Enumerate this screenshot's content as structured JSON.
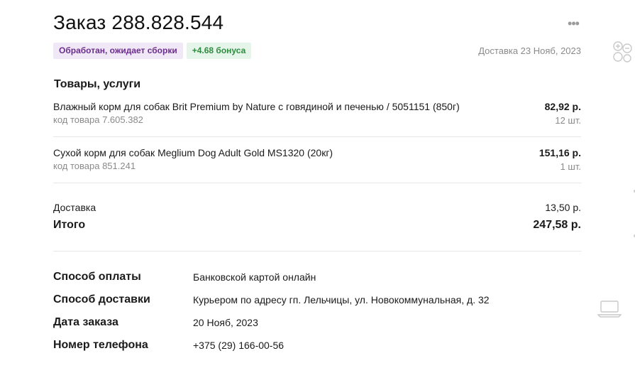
{
  "order": {
    "title": "Заказ 288.828.544",
    "status_badge": "Обработан, ожидает сборки",
    "bonus_badge": "+4.68 бонуса",
    "delivery_date": "Доставка 23 Нояб, 2023",
    "more_icon": "more-dots-icon"
  },
  "items_section": {
    "title": "Товары, услуги",
    "items": [
      {
        "name": "Влажный корм для собак Brit Premium by Nature с говядиной и печенью / 5051151 (850г)",
        "code": "код товара 7.605.382",
        "price": "82,92 р.",
        "qty": "12 шт."
      },
      {
        "name": "Сухой корм для собак Meglium Dog Adult Gold MS1320 (20кг)",
        "code": "код товара 851.241",
        "price": "151,16 р.",
        "qty": "1 шт."
      }
    ]
  },
  "summary": {
    "delivery_label": "Доставка",
    "delivery_value": "13,50 р.",
    "total_label": "Итого",
    "total_value": "247,58 р."
  },
  "details": [
    {
      "label": "Способ оплаты",
      "value": "Банковской картой онлайн"
    },
    {
      "label": "Способ доставки",
      "value": "Курьером по адресу гп. Лельчицы, ул. Новокоммунальная, д. 32"
    },
    {
      "label": "Дата заказа",
      "value": "20 Нояб, 2023"
    },
    {
      "label": "Номер телефона",
      "value": "+375 (29) 166-00-56"
    }
  ],
  "side_icons": {
    "top": "accessibility-icon",
    "bottom": "laptop-icon"
  },
  "colors": {
    "status_bg": "#f1e8f7",
    "status_text": "#6a2e8c",
    "bonus_bg": "#e6f5ea",
    "bonus_text": "#2e8b3e",
    "muted": "#8a8a8a",
    "divider": "#e6e6e6"
  }
}
